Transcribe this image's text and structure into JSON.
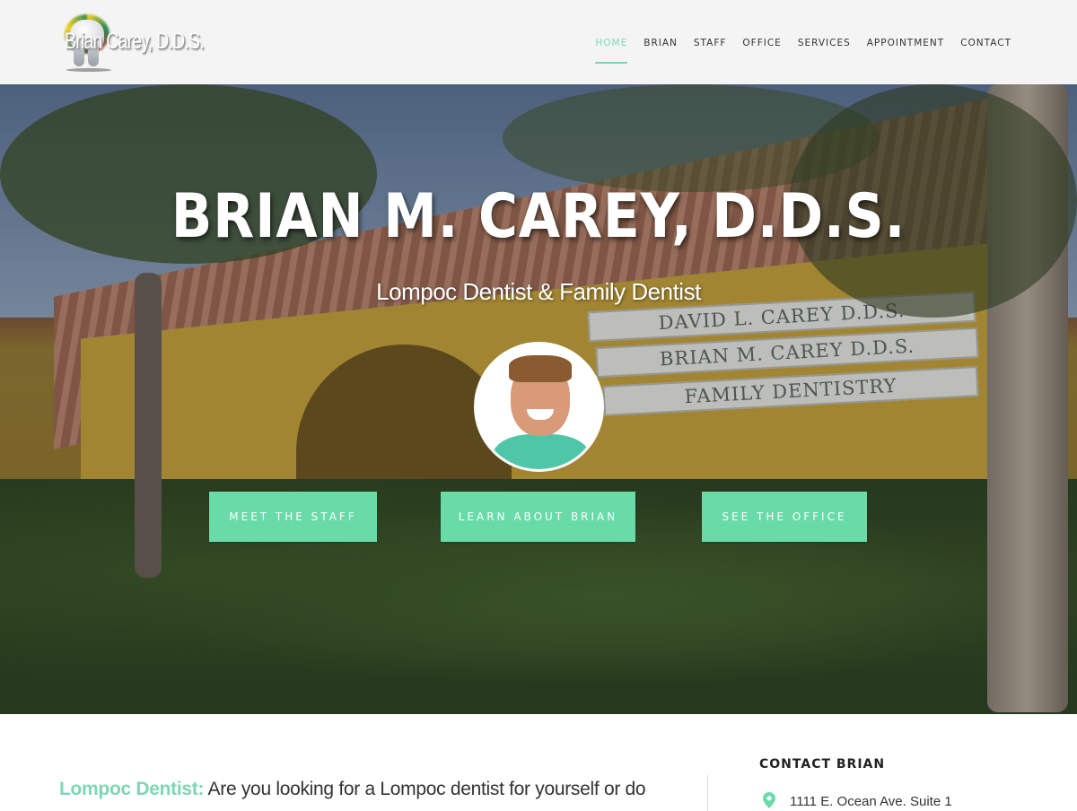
{
  "header": {
    "logo_text": "Brian Carey, D.D.S.",
    "nav": [
      {
        "label": "HOME",
        "active": true
      },
      {
        "label": "BRIAN",
        "active": false
      },
      {
        "label": "STAFF",
        "active": false
      },
      {
        "label": "OFFICE",
        "active": false
      },
      {
        "label": "SERVICES",
        "active": false
      },
      {
        "label": "APPOINTMENT",
        "active": false
      },
      {
        "label": "CONTACT",
        "active": false
      }
    ]
  },
  "hero": {
    "title": "BRIAN M. CAREY, D.D.S.",
    "subtitle": "Lompoc Dentist & Family Dentist",
    "signs": [
      "DAVID L. CAREY D.D.S.",
      "BRIAN M. CAREY D.D.S.",
      "FAMILY DENTISTRY"
    ],
    "buttons": [
      "MEET THE STAFF",
      "LEARN ABOUT BRIAN",
      "SEE THE OFFICE"
    ]
  },
  "content": {
    "intro_lead": "Lompoc Dentist:",
    "intro_text": " Are you looking for a Lompoc dentist for yourself or do",
    "contact_title": "CONTACT BRIAN",
    "address": "1111 E. Ocean Ave. Suite 1"
  },
  "colors": {
    "accent": "#68dba9",
    "nav_active": "#7fd6b5",
    "header_bg": "#f4f4f4"
  }
}
